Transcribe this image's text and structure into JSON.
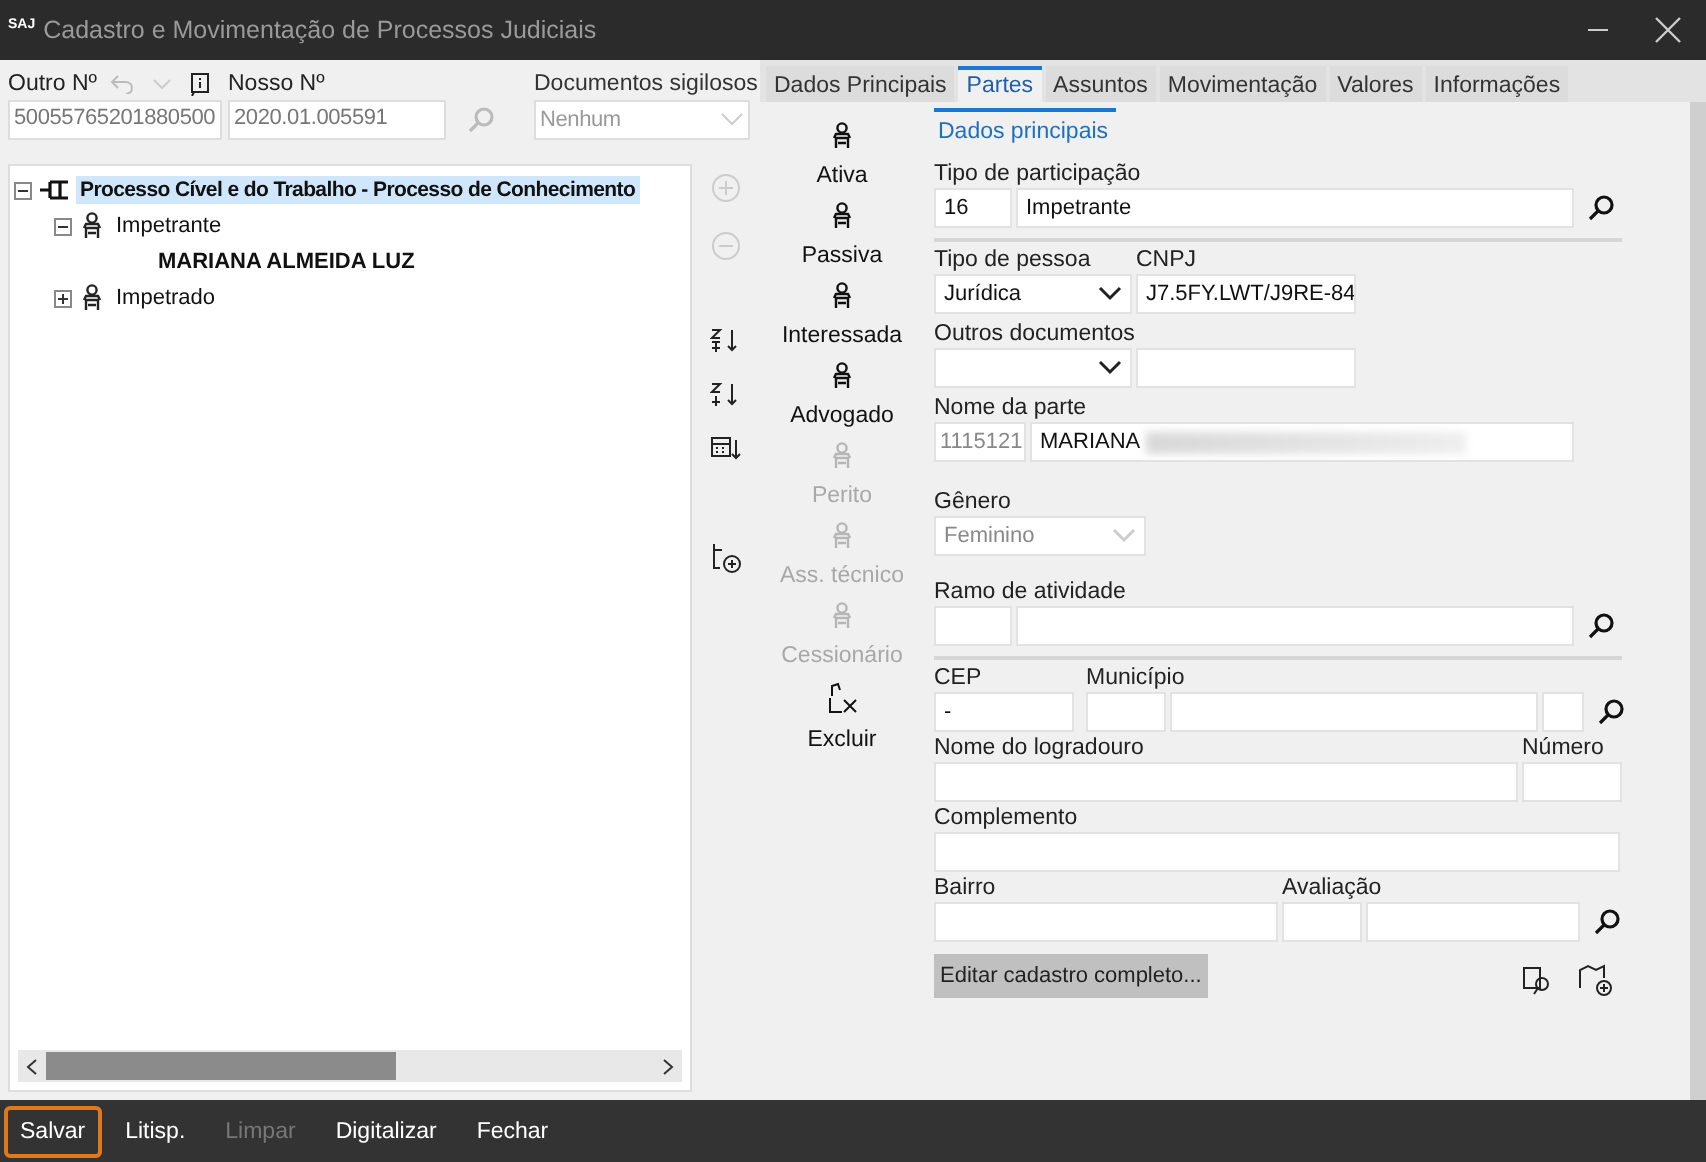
{
  "window": {
    "logo": "SAJ",
    "title": "Cadastro e Movimentação de Processos Judiciais"
  },
  "header": {
    "outro_label": "Outro Nº",
    "outro_value": "50055765201880500",
    "nosso_label": "Nosso Nº",
    "nosso_value": "2020.01.005591",
    "sigilosos_label": "Documentos sigilosos",
    "sigilosos_value": "Nenhum"
  },
  "tree": [
    {
      "label": "Processo Cível e do Trabalho - Processo de Conhecimento",
      "kind": "process",
      "expanded": true,
      "selected": true,
      "children": [
        {
          "label": "Impetrante",
          "kind": "party",
          "expanded": true,
          "selected": false,
          "children": [
            {
              "label": "MARIANA ALMEIDA LUZ",
              "kind": "person",
              "selected": false
            }
          ]
        },
        {
          "label": "Impetrado",
          "kind": "party",
          "expanded": false,
          "selected": false
        }
      ]
    }
  ],
  "tabs": [
    {
      "label": "Dados Principais",
      "selected": false
    },
    {
      "label": "Partes",
      "selected": true
    },
    {
      "label": "Assuntos",
      "selected": false
    },
    {
      "label": "Movimentação",
      "selected": false
    },
    {
      "label": "Valores",
      "selected": false
    },
    {
      "label": "Informações",
      "selected": false
    }
  ],
  "party_types": [
    {
      "label": "Ativa",
      "disabled": false,
      "kind": "person"
    },
    {
      "label": "Passiva",
      "disabled": false,
      "kind": "person"
    },
    {
      "label": "Interessada",
      "disabled": false,
      "kind": "person"
    },
    {
      "label": "Advogado",
      "disabled": false,
      "kind": "person"
    },
    {
      "label": "Perito",
      "disabled": true,
      "kind": "person"
    },
    {
      "label": "Ass. técnico",
      "disabled": true,
      "kind": "person"
    },
    {
      "label": "Cessionário",
      "disabled": true,
      "kind": "person"
    },
    {
      "label": "Excluir",
      "disabled": false,
      "kind": "delete"
    }
  ],
  "form": {
    "section_tab": "Dados principais",
    "tipo_participacao": {
      "label": "Tipo de participação",
      "code": "16",
      "value": "Impetrante"
    },
    "tipo_pessoa": {
      "label": "Tipo de pessoa",
      "value": "Jurídica"
    },
    "cnpj": {
      "label": "CNPJ",
      "value": "J7.5FY.LWT/J9RE-84"
    },
    "outros_documentos": {
      "label": "Outros documentos"
    },
    "nome_parte": {
      "label": "Nome da parte",
      "code": "1115121",
      "value": "MARIANA"
    },
    "genero": {
      "label": "Gênero",
      "value": "Feminino",
      "disabled": true
    },
    "ramo": {
      "label": "Ramo de atividade"
    },
    "cep": {
      "label": "CEP",
      "value": "-"
    },
    "municipio": {
      "label": "Município"
    },
    "logradouro": {
      "label": "Nome do logradouro"
    },
    "numero": {
      "label": "Número"
    },
    "complemento": {
      "label": "Complemento"
    },
    "bairro": {
      "label": "Bairro"
    },
    "avaliacao": {
      "label": "Avaliação"
    },
    "edit_button": "Editar cadastro completo..."
  },
  "footer": [
    {
      "label": "Salvar",
      "disabled": false,
      "focused": true
    },
    {
      "label": "Litisp.",
      "disabled": false,
      "focused": false
    },
    {
      "label": "Limpar",
      "disabled": true,
      "focused": false
    },
    {
      "label": "Digitalizar",
      "disabled": false,
      "focused": false
    },
    {
      "label": "Fechar",
      "disabled": false,
      "focused": false
    }
  ]
}
